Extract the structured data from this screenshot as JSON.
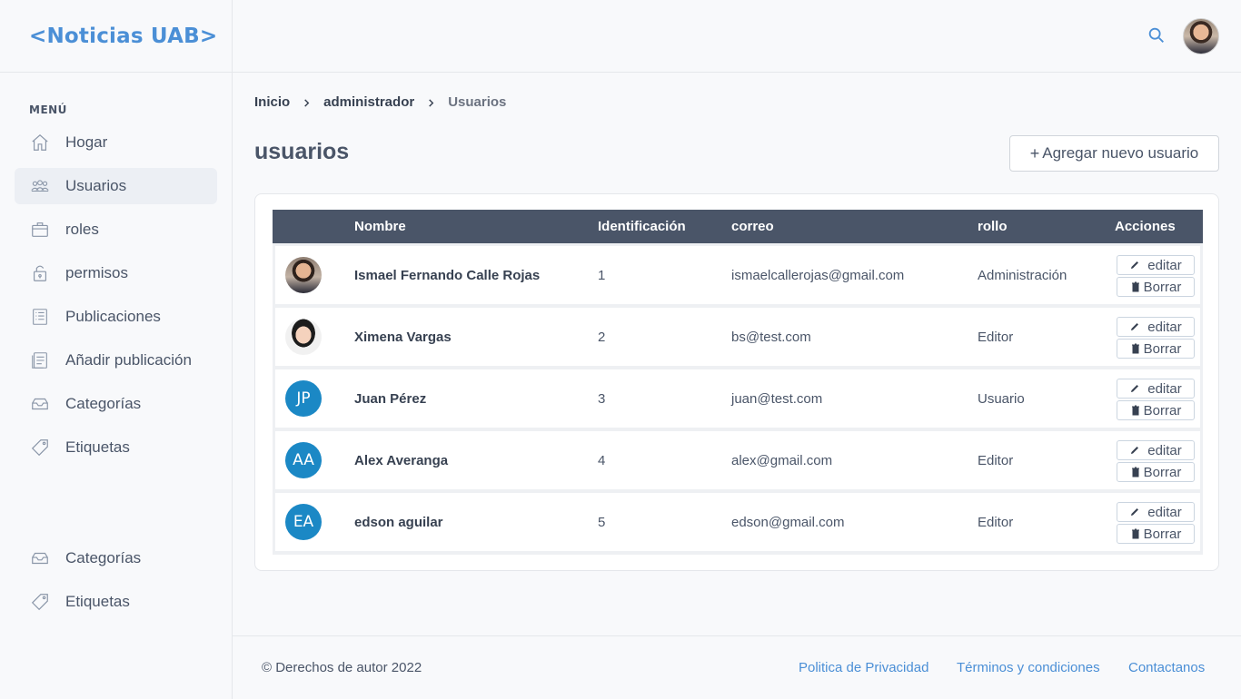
{
  "app": {
    "logo": "<Noticias UAB>"
  },
  "sidebar": {
    "menu_title": "MENÚ",
    "items": [
      {
        "label": "Hogar",
        "icon": "home-icon"
      },
      {
        "label": "Usuarios",
        "icon": "users-icon",
        "active": true
      },
      {
        "label": "roles",
        "icon": "briefcase-icon"
      },
      {
        "label": "permisos",
        "icon": "lock-icon"
      },
      {
        "label": "Publicaciones",
        "icon": "list-icon"
      },
      {
        "label": "Añadir publicación",
        "icon": "document-add-icon"
      },
      {
        "label": "Categorías",
        "icon": "inbox-icon"
      },
      {
        "label": "Etiquetas",
        "icon": "tag-icon"
      }
    ],
    "bottom_items": [
      {
        "label": "Categorías",
        "icon": "inbox-icon"
      },
      {
        "label": "Etiquetas",
        "icon": "tag-icon"
      }
    ]
  },
  "header": {
    "search_icon": "search-icon",
    "avatar": "user-avatar"
  },
  "breadcrumb": {
    "items": [
      "Inicio",
      "administrador"
    ],
    "current": "Usuarios",
    "separator": ">"
  },
  "main": {
    "title": "usuarios",
    "add_button": "Agregar nuevo usuario",
    "add_button_icon": "+"
  },
  "table": {
    "columns": [
      "Nombre",
      "Identificación",
      "correo",
      "rollo",
      "Acciones"
    ],
    "rows": [
      {
        "avatar": "photo",
        "name": "Ismael Fernando Calle Rojas",
        "id": "1",
        "email": "ismaelcallerojas@gmail.com",
        "role": "Administración"
      },
      {
        "avatar": "photo",
        "name": "Ximena Vargas",
        "id": "2",
        "email": "bs@test.com",
        "role": "Editor"
      },
      {
        "avatar": "JP",
        "name": "Juan Pérez",
        "id": "3",
        "email": "juan@test.com",
        "role": "Usuario"
      },
      {
        "avatar": "AA",
        "name": "Alex Averanga",
        "id": "4",
        "email": "alex@gmail.com",
        "role": "Editor"
      },
      {
        "avatar": "EA",
        "name": "edson aguilar",
        "id": "5",
        "email": "edson@gmail.com",
        "role": "Editor"
      }
    ],
    "edit_label": "editar",
    "delete_label": "Borrar"
  },
  "footer": {
    "copyright": "© Derechos de autor 2022",
    "links": [
      "Politica de Privacidad",
      "Términos y condiciones",
      "Contactanos"
    ]
  },
  "colors": {
    "brand": "#4b8fd6",
    "table_header": "#4a5568",
    "avatar_initials_bg": "#1b88c5",
    "active_nav_bg": "#eceff4"
  }
}
